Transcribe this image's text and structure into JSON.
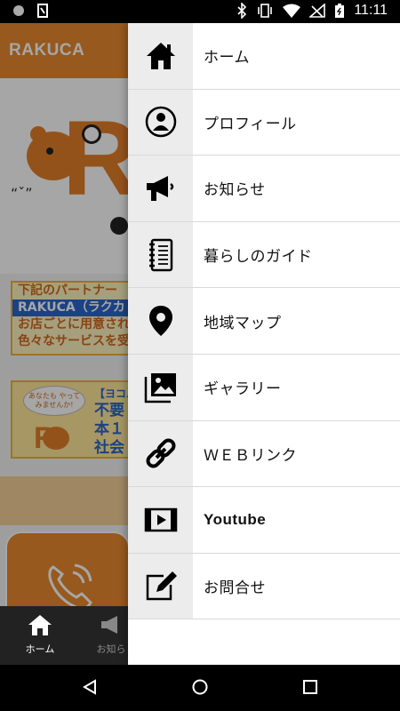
{
  "status": {
    "time": "11:11"
  },
  "app": {
    "title": "RAKUCA",
    "hero_quote": "“ˇ”",
    "banner1_lines": [
      "下記のパートナー",
      "RAKUCA（ラクカ",
      "お店ごとに用意され",
      "色々なサービスを受"
    ],
    "banner2": {
      "speech": "あなたも やって みませんか!",
      "heading": "【ヨコハ",
      "body": "不要\n本１\n社会"
    },
    "tabs": [
      {
        "label": "ホーム",
        "icon": "home-icon"
      },
      {
        "label": "お知ら",
        "icon": "megaphone-icon"
      }
    ]
  },
  "drawer": {
    "items": [
      {
        "label": "ホーム",
        "icon": "home-icon"
      },
      {
        "label": "プロフィール",
        "icon": "profile-icon"
      },
      {
        "label": "お知らせ",
        "icon": "megaphone-icon"
      },
      {
        "label": "暮らしのガイド",
        "icon": "notebook-icon"
      },
      {
        "label": "地域マップ",
        "icon": "map-pin-icon"
      },
      {
        "label": "ギャラリー",
        "icon": "gallery-icon"
      },
      {
        "label": "ＷＥＢリンク",
        "icon": "link-icon"
      },
      {
        "label": "Youtube",
        "icon": "video-icon"
      },
      {
        "label": "お問合せ",
        "icon": "edit-icon"
      }
    ]
  },
  "colors": {
    "brand_orange": "#e8892f",
    "drawer_icon_bg": "#ececec"
  }
}
